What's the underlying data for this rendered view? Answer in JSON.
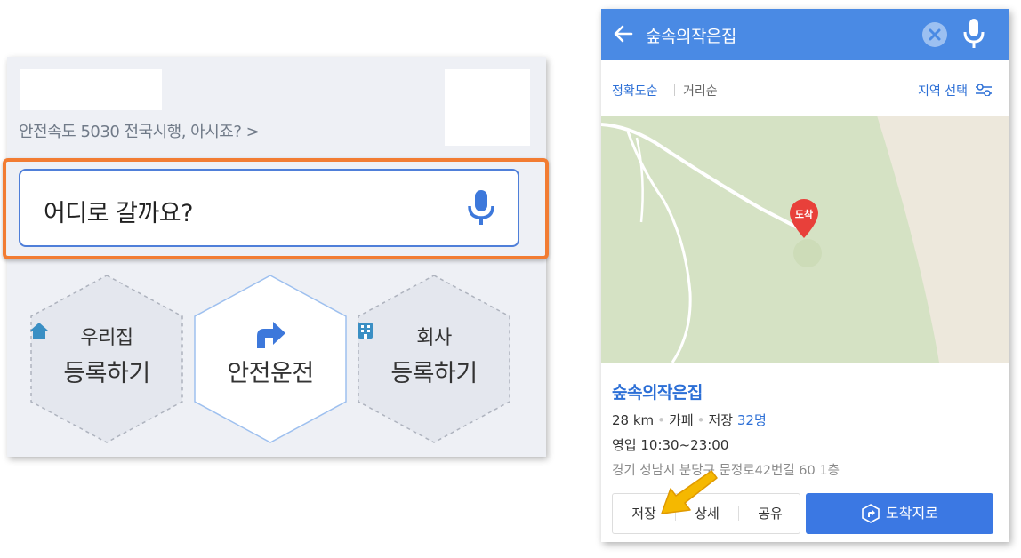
{
  "left": {
    "notice": "안전속도 5030 전국시행, 아시죠? >",
    "search": {
      "placeholder": "어디로 갈까요?"
    },
    "shortcuts": [
      {
        "label_top": "우리집",
        "label_bottom": "등록하기",
        "icon": "home-icon"
      },
      {
        "label_bottom": "안전운전",
        "icon": "turn-right-arrow-icon"
      },
      {
        "label_top": "회사",
        "label_bottom": "등록하기",
        "icon": "building-icon"
      }
    ]
  },
  "right": {
    "header": {
      "query": "숲속의작은집"
    },
    "sort": {
      "accuracy": "정확도순",
      "distance": "거리순",
      "region": "지역 선택"
    },
    "map": {
      "pin_label": "도착"
    },
    "place": {
      "name": "숲속의작은집",
      "distance": "28 km",
      "category": "카페",
      "saved_label": "저장",
      "saved_count": "32명",
      "hours": "영업 10:30~23:00",
      "address": "경기 성남시 분당구 문정로42번길 60 1층"
    },
    "actions": {
      "save": "저장",
      "detail": "상세",
      "share": "공유",
      "arrive": "도착지로"
    }
  },
  "colors": {
    "accent_blue": "#4a8ae4",
    "highlight_orange": "#f27c32",
    "arrow_yellow": "#f5b800",
    "pin_red": "#e8403a"
  }
}
